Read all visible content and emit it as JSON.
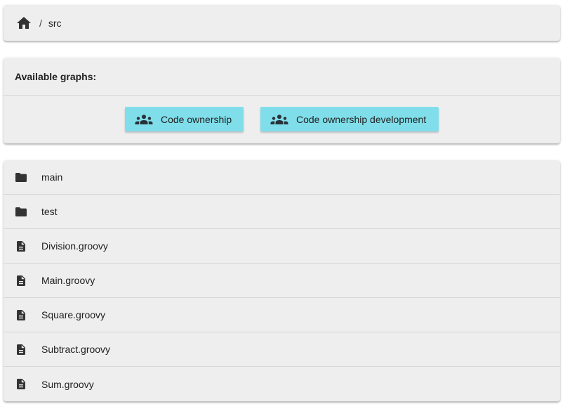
{
  "breadcrumb": {
    "home_icon": "home-icon",
    "separator": "/",
    "current": "src"
  },
  "graphs": {
    "title": "Available graphs:",
    "buttons": [
      {
        "label": "Code ownership",
        "icon": "people-group-icon"
      },
      {
        "label": "Code ownership development",
        "icon": "people-group-icon"
      }
    ],
    "button_color": "#80deea"
  },
  "files": [
    {
      "name": "main",
      "type": "folder",
      "icon": "folder-icon"
    },
    {
      "name": "test",
      "type": "folder",
      "icon": "folder-icon"
    },
    {
      "name": "Division.groovy",
      "type": "file",
      "icon": "file-icon"
    },
    {
      "name": "Main.groovy",
      "type": "file",
      "icon": "file-icon"
    },
    {
      "name": "Square.groovy",
      "type": "file",
      "icon": "file-icon"
    },
    {
      "name": "Subtract.groovy",
      "type": "file",
      "icon": "file-icon"
    },
    {
      "name": "Sum.groovy",
      "type": "file",
      "icon": "file-icon"
    }
  ]
}
